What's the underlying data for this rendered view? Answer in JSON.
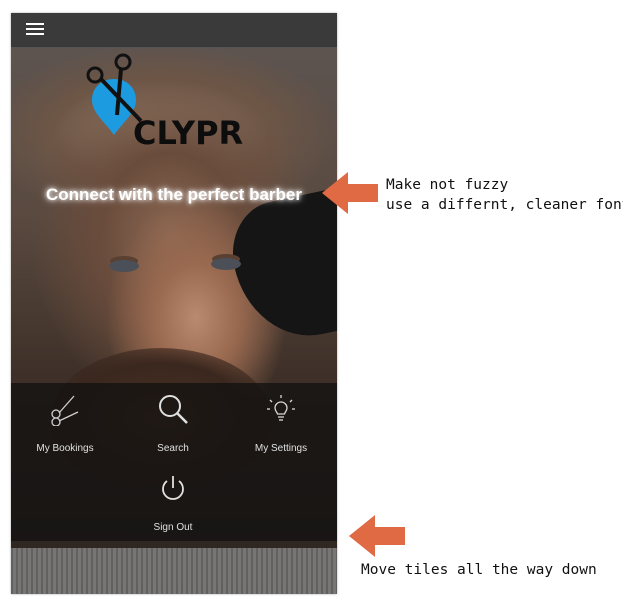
{
  "app": {
    "logo_text": "CLYPR",
    "tagline": "Connect with the perfect barber",
    "menu_icon": "hamburger-icon"
  },
  "tiles": [
    {
      "label": "My Bookings",
      "icon": "scissors-icon"
    },
    {
      "label": "Search",
      "icon": "search-icon"
    },
    {
      "label": "My Settings",
      "icon": "lightbulb-icon"
    },
    {
      "label": "Sign Out",
      "icon": "power-icon"
    }
  ],
  "annotations": {
    "font_note_line1": "Make not fuzzy",
    "font_note_line2": "use a differnt, cleaner font",
    "tiles_note": "Move tiles all the way down",
    "arrow_color": "#e06a44"
  },
  "colors": {
    "logo_blue": "#1c9be0",
    "topbar": "#3a3a3a",
    "tile_panel": "rgba(15,15,15,.72)"
  }
}
